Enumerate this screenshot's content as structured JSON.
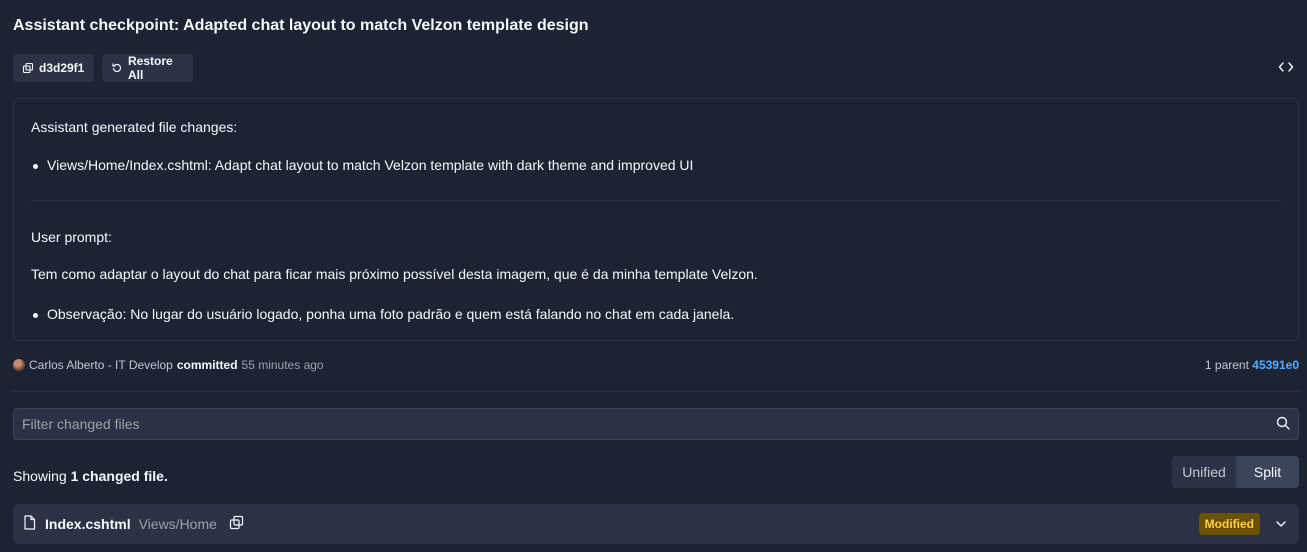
{
  "header": {
    "title": "Assistant checkpoint: Adapted chat layout to match Velzon template design",
    "commit_hash": "d3d29f1",
    "restore_label": "Restore All"
  },
  "message": {
    "assistant_heading": "Assistant generated file changes:",
    "assistant_items": [
      "Views/Home/Index.cshtml: Adapt chat layout to match Velzon template with dark theme and improved UI"
    ],
    "user_heading": "User prompt:",
    "user_text": "Tem como adaptar o layout do chat para ficar mais próximo possível desta imagem, que é da minha template Velzon.",
    "user_items": [
      "Observação: No lugar do usuário logado, ponha uma foto padrão e quem está falando no chat em cada janela."
    ]
  },
  "commit": {
    "author": "Carlos Alberto - IT Develop",
    "verb": "committed",
    "when": "55 minutes ago",
    "parent_label": "1 parent",
    "parent_hash": "45391e0"
  },
  "filter": {
    "placeholder": "Filter changed files"
  },
  "summary": {
    "prefix": "Showing",
    "count": "1 changed file.",
    "view_unified": "Unified",
    "view_split": "Split",
    "selected_view": "Split"
  },
  "files": [
    {
      "name": "Index.cshtml",
      "path": "Views/Home",
      "status": "Modified"
    }
  ],
  "colors": {
    "background": "#1c2333",
    "surface": "#2b3245",
    "link": "#57abff",
    "modified_bg": "#6b5000",
    "modified_fg": "#ffcf3f"
  },
  "icons": [
    "commit-copy-icon",
    "restore-icon",
    "code-icon",
    "search-icon",
    "file-icon",
    "copy-icon",
    "chevron-down-icon"
  ]
}
